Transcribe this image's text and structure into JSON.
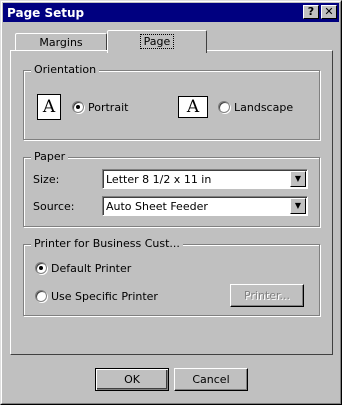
{
  "window": {
    "title": "Page Setup",
    "help_glyph": "?",
    "close_glyph": "✕"
  },
  "tabs": [
    {
      "label": "Margins"
    },
    {
      "label": "Page"
    }
  ],
  "orientation": {
    "label": "Orientation",
    "portrait": {
      "label": "Portrait",
      "icon_glyph": "A",
      "selected": true
    },
    "landscape": {
      "label": "Landscape",
      "icon_glyph": "A",
      "selected": false
    }
  },
  "paper": {
    "label": "Paper",
    "size": {
      "label": "Size:",
      "value": "Letter 8 1/2 x 11 in"
    },
    "source": {
      "label": "Source:",
      "value": "Auto Sheet Feeder"
    },
    "arrow_glyph": "▼"
  },
  "printer": {
    "label": "Printer for Business Cust...",
    "default": {
      "label": "Default Printer",
      "selected": true
    },
    "specific": {
      "label": "Use Specific Printer",
      "selected": false
    },
    "printer_button": "Printer..."
  },
  "buttons": {
    "ok": "OK",
    "cancel": "Cancel"
  }
}
